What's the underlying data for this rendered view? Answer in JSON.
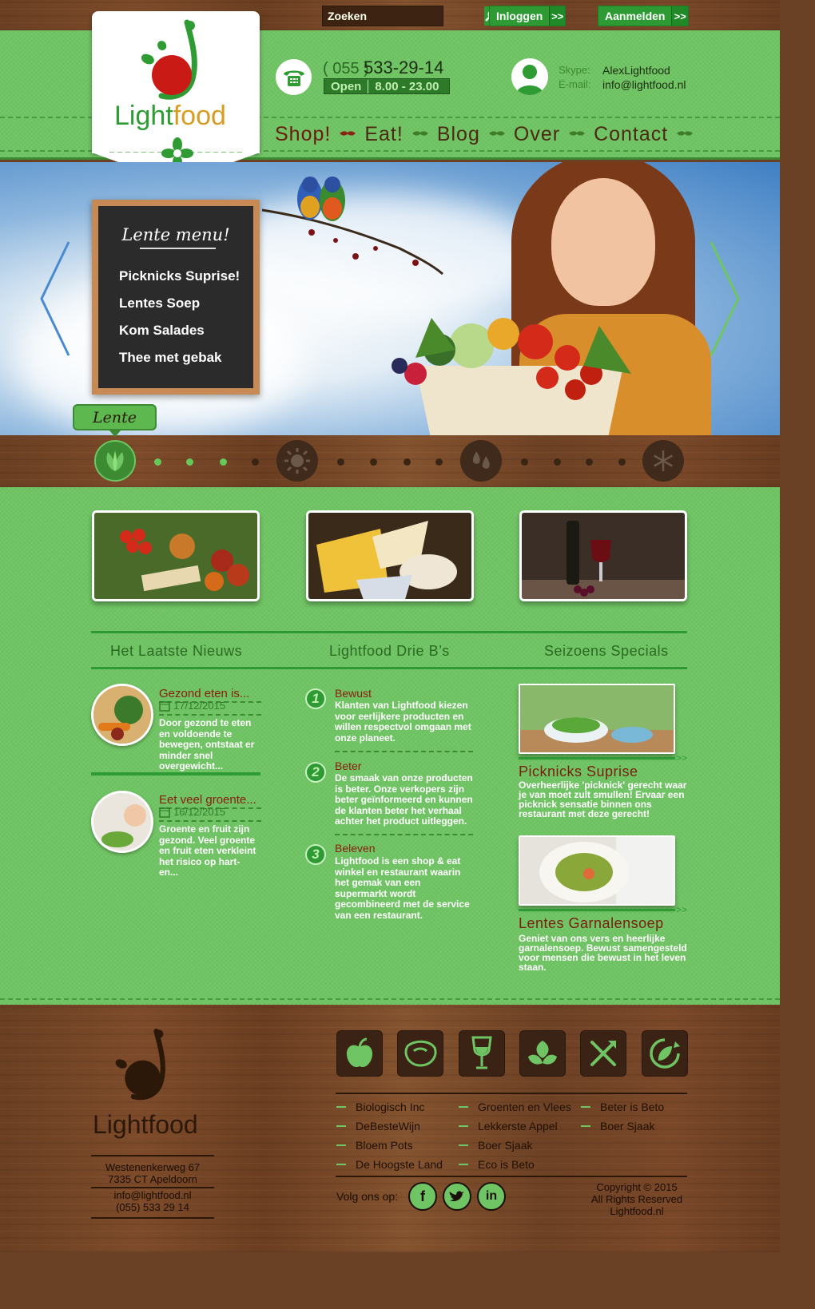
{
  "topbar": {
    "search_placeholder": "Zoeken",
    "login_label": "Inloggen",
    "signup_label": "Aanmelden",
    "arrow": ">>"
  },
  "brand": {
    "name_light": "Light",
    "name_food": "food"
  },
  "contact": {
    "area_code": "( 055 )",
    "phone": "533-29-14",
    "open_label": "Open",
    "hours": "8.00 - 23.00",
    "skype_label": "Skype:",
    "skype": "AlexLightfood",
    "email_label": "E-mail:",
    "email": "info@lightfood.nl"
  },
  "nav": {
    "items": [
      "Shop!",
      "Eat!",
      "Blog",
      "Over",
      "Contact"
    ]
  },
  "hero": {
    "menu_title": "Lente menu!",
    "menu_items": [
      "Picknicks Suprise!",
      "Lentes Soep",
      "Kom Salades",
      "Thee met gebak"
    ],
    "season_tag": "Lente"
  },
  "sections": {
    "news": "Het Laatste Nieuws",
    "bs": "Lightfood Drie B’s",
    "specials": "Seizoens Specials"
  },
  "news": [
    {
      "title": "Gezond eten is...",
      "date": "17/12/2015",
      "text": "Door gezond te eten en voldoende te bewegen, ontstaat er minder snel overgewicht..."
    },
    {
      "title": "Eet veel groente...",
      "date": "16/12/2015",
      "text": "Groente en fruit zijn gezond. Veel groente en fruit eten verkleint het risico op hart- en..."
    }
  ],
  "bs": [
    {
      "num": "1",
      "title": "Bewust",
      "text": "Klanten van Lightfood kiezen voor eerlijkere producten en willen respectvol omgaan met onze planeet."
    },
    {
      "num": "2",
      "title": "Beter",
      "text": "De smaak van onze producten is beter. Onze verkopers zijn beter geïnformeerd en kunnen de klanten beter het verhaal achter het product uitleggen."
    },
    {
      "num": "3",
      "title": "Beleven",
      "text": "Lightfood is een shop & eat winkel en restaurant waarin het gemak van een supermarkt wordt gecombineerd met de service van een restaurant."
    }
  ],
  "specials": [
    {
      "title": "Picknicks Suprise",
      "text": "Overheerlijke 'picknick' gerecht waar je van moet zult smullen! Ervaar een picknick sensatie binnen ons restaurant met deze gerecht!"
    },
    {
      "title": "Lentes Garnalensoep",
      "text": "Geniet van ons vers en heerlijke garnalensoep. Bewust samengesteld voor mensen die bewust in het leven staan."
    }
  ],
  "footer": {
    "address1": "Westenenkerweg 67",
    "address2": "7335 CT Apeldoorn",
    "email": "info@lightfood.nl",
    "phone": "(055) 533 29 14",
    "links_col1": [
      "Biologisch Inc",
      "DeBesteWijn",
      "Bloem Pots",
      "De Hoogste Land"
    ],
    "links_col2": [
      "Groenten en Vlees",
      "Lekkerste Appel",
      "Boer Sjaak",
      "Eco is Beto"
    ],
    "links_col3": [
      "Beter is Beto",
      "Boer Sjaak"
    ],
    "follow_label": "Volg ons op:",
    "copyright1": "Copyright © 2015",
    "copyright2": "All Rights Reserved",
    "copyright3": "Lightfood.nl"
  },
  "colors": {
    "green": "#6fc563",
    "dark_green": "#2d9a33",
    "brown": "#6b4126",
    "red": "#8a1e0e"
  }
}
